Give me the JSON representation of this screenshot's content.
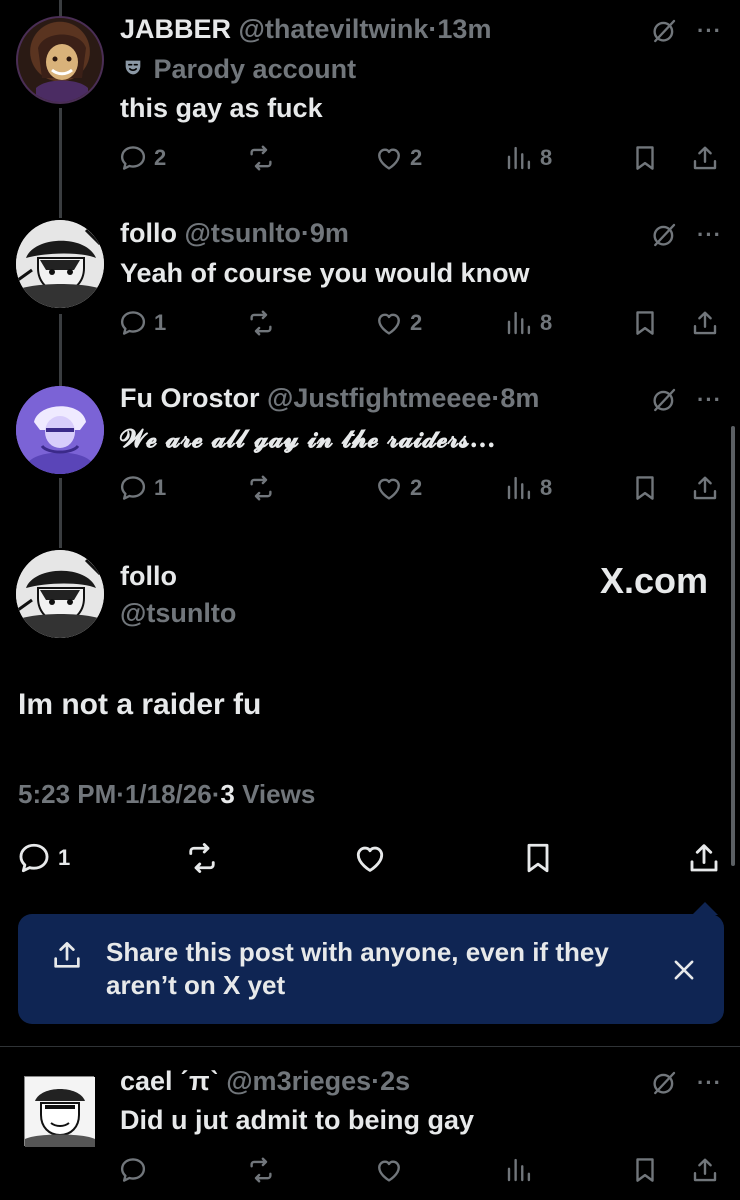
{
  "replies": [
    {
      "name": "JABBER",
      "handle": "@thateviltwink",
      "sep": "·",
      "time": "13m",
      "badge": "Parody account",
      "text": "this gay as fuck",
      "replies": "2",
      "likes": "2",
      "views": "8"
    },
    {
      "name": "follo",
      "handle": "@tsunlto",
      "sep": "·",
      "time": "9m",
      "text": "Yeah of course you would know",
      "replies": "1",
      "likes": "2",
      "views": "8"
    },
    {
      "name": "Fu Orostor",
      "handle": "@Justfightmeeee",
      "sep": "·",
      "time": "8m",
      "text": "𝓦𝓮 𝓪𝓻𝓮 𝓪𝓵𝓵 𝓰𝓪𝔂 𝓲𝓷 𝓽𝓱𝓮 𝓻𝓪𝓲𝓭𝓮𝓻𝓼...",
      "replies": "1",
      "likes": "2",
      "views": "8"
    }
  ],
  "main_post": {
    "name": "follo",
    "handle": "@tsunlto",
    "watermark": "X.com",
    "text": "Im not a raider fu",
    "time": "5:23 PM",
    "date": "1/18/26",
    "views_count": "3",
    "views_label": "Views",
    "sep": "·",
    "replies": "1"
  },
  "share_banner": {
    "text_line1": "Share this post with anyone, even if they",
    "text_line2": "aren’t on X yet"
  },
  "bottom_reply": {
    "name": "cael ˊπˋ",
    "handle": "@m3rieges",
    "sep": "·",
    "time": "2s",
    "text": "Did u jut admit to being gay"
  },
  "colors": {
    "background": "#000000",
    "text": "#e7e9ea",
    "muted": "#71767b",
    "banner": "#0f2553"
  },
  "icons": [
    "reply-icon",
    "repost-icon",
    "like-icon",
    "views-icon",
    "bookmark-icon",
    "share-icon",
    "grok-icon",
    "more-icon",
    "close-icon",
    "parody-mask-icon"
  ]
}
